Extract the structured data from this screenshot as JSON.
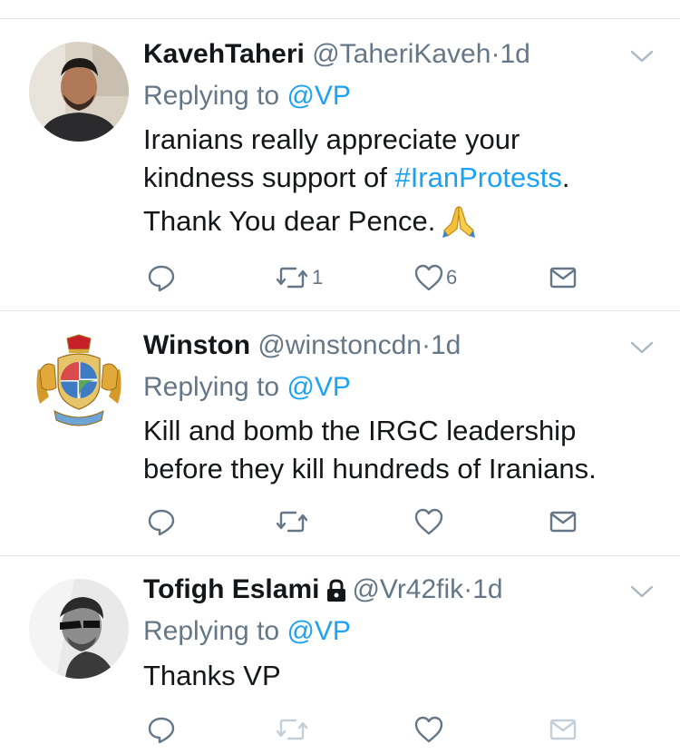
{
  "tweets": [
    {
      "name": "KavehTaheri",
      "handle": "@TaheriKaveh",
      "dot": "·",
      "time": "1d",
      "replying_prefix": "Replying to ",
      "replying_to": "@VP",
      "body_line1": "Iranians really appreciate your",
      "body_line2_prefix": "kindness support of ",
      "hashtag": "#IranProtests",
      "body_line2_suffix": ".",
      "body_line3": "Thank You dear Pence. ",
      "emoji": "folded-hands",
      "retweets": "1",
      "likes": "6",
      "protected": false
    },
    {
      "name": "Winston",
      "handle": "@winstoncdn",
      "dot": "·",
      "time": "1d",
      "replying_prefix": "Replying to ",
      "replying_to": "@VP",
      "body_line1": "Kill and bomb the IRGC leadership",
      "body_line2": "before they kill hundreds of Iranians.",
      "retweets": "",
      "likes": "",
      "protected": false
    },
    {
      "name": "Tofigh Eslami",
      "handle": "@Vr42fik",
      "dot": "·",
      "time": "1d",
      "replying_prefix": "Replying to ",
      "replying_to": "@VP",
      "body_line1": "Thanks VP",
      "retweets": "",
      "likes": "",
      "protected": true
    }
  ],
  "icons": {
    "reply": "reply-icon",
    "retweet": "retweet-icon",
    "like": "heart-icon",
    "dm": "envelope-icon",
    "more": "chevron-down-icon",
    "lock": "lock-icon"
  },
  "colors": {
    "link": "#1da1f2",
    "secondary": "#657786",
    "text": "#14171a",
    "divider": "#e1e8ed",
    "action_icon": "#657786",
    "disabled_icon": "#c4ced6"
  }
}
